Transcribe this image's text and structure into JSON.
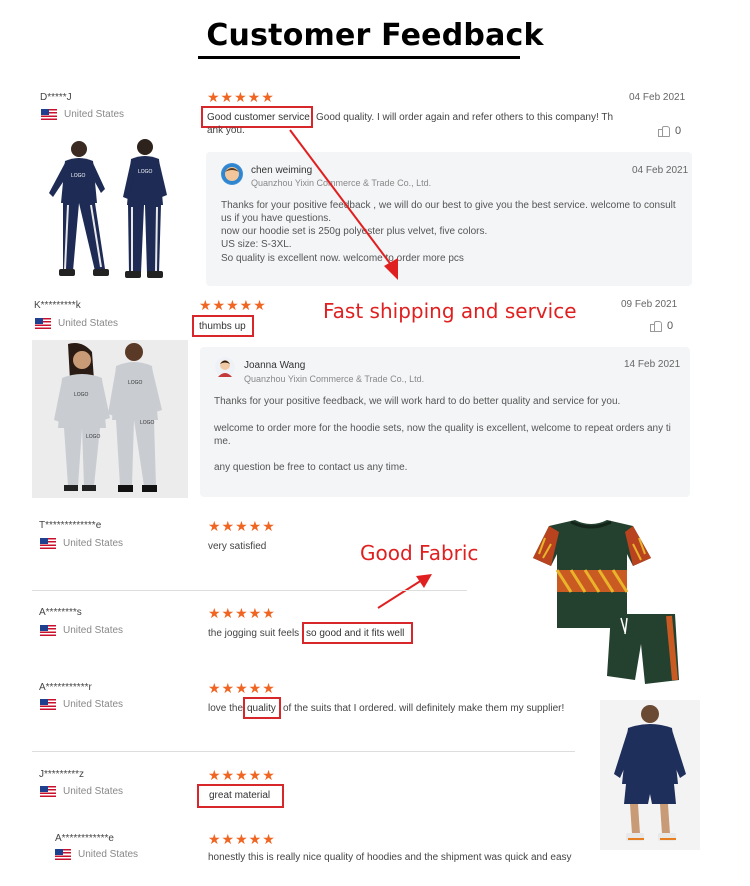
{
  "page": {
    "title": "Customer Feedback"
  },
  "colors": {
    "star": "#f06522",
    "annotation_red": "#e02020"
  },
  "reviews": [
    {
      "user": "D*****J",
      "country": "United States",
      "stars": "★★★★★",
      "date": "04 Feb 2021",
      "highlight": "Good customer service",
      "text_after": "Good quality. I will order again and refer others to this company! Th",
      "text_line2": "ank you.",
      "likes": "0",
      "reply": {
        "name": "chen weiming",
        "company": "Quanzhou Yixin Commerce & Trade Co., Ltd.",
        "date": "04 Feb 2021",
        "lines": [
          "Thanks for your positive feedback , we will do our best to give you the best service. welcome to consult",
          "us if you have questions.",
          "now our hoodie set is 250g polyester plus velvet, five colors.",
          "US size: S-3XL.",
          "So quality is excellent now.  welcome to order more pcs"
        ]
      }
    },
    {
      "user": "K*********k",
      "country": "United States",
      "stars": "★★★★★",
      "date": "09 Feb 2021",
      "highlight": "thumbs up",
      "likes": "0",
      "reply": {
        "name": "Joanna Wang",
        "company": "Quanzhou Yixin Commerce & Trade Co., Ltd.",
        "date": "14 Feb 2021",
        "lines": [
          "Thanks for your positive feedback, we will work hard to do  better quality and service for you.",
          "welcome to order more for the hoodie sets,  now the quality is excellent,  welcome to repeat orders any ti",
          "me.",
          "any question be free to contact us any time."
        ]
      }
    },
    {
      "user": "T*************e",
      "country": "United States",
      "stars": "★★★★★",
      "text": "very satisfied"
    },
    {
      "user": "A********s",
      "country": "United States",
      "stars": "★★★★★",
      "text_before": "the jogging suit feels",
      "highlight": "so good and it fits well"
    },
    {
      "user": "A***********r",
      "country": "United States",
      "stars": "★★★★★",
      "text_before": "love the",
      "highlight": "quality",
      "text_after": "of the suits that I ordered. will definitely make them my supplier!"
    },
    {
      "user": "J*********z",
      "country": "United States",
      "stars": "★★★★★",
      "highlight": "great material"
    },
    {
      "user": "A************e",
      "country": "United States",
      "stars": "★★★★★",
      "text": "honestly this is really nice quality of hoodies and the shipment was quick and easy"
    }
  ],
  "annotations": {
    "shipping": "Fast shipping and service",
    "fabric": "Good Fabric"
  },
  "product_logo": "LOGO"
}
